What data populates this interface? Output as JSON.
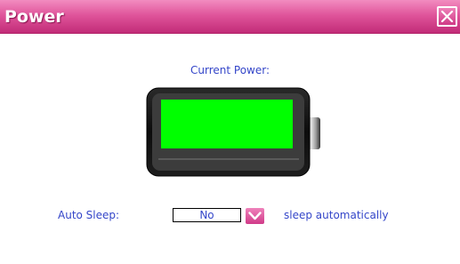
{
  "window": {
    "title": "Power",
    "title_color": "#ffffff",
    "titlebar_color": "#e0559b"
  },
  "icons": {
    "close": "close-icon",
    "battery": "battery-icon",
    "dropdown": "chevron-down-icon"
  },
  "battery": {
    "label": "Current Power:",
    "level": 1.0,
    "fill_color": "#00ff00"
  },
  "auto_sleep": {
    "label": "Auto Sleep:",
    "selected_value": "No",
    "description": "sleep automatically"
  },
  "colors": {
    "text_accent": "#3446c9",
    "button_pink": "#d03a88"
  }
}
